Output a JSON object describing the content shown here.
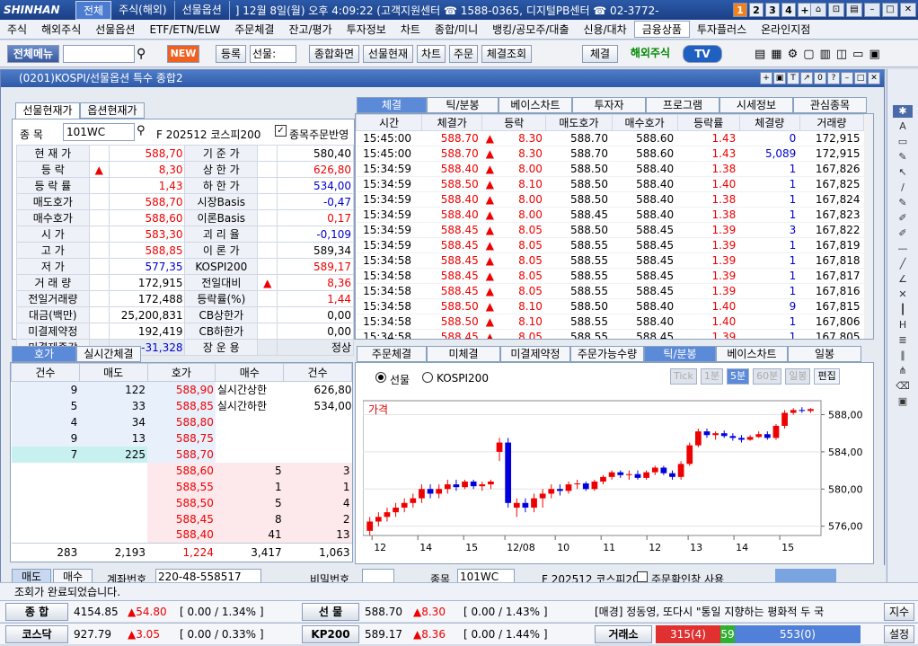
{
  "titlebar": {
    "logo": "SHINHAN",
    "tabs": [
      "전체",
      "주식(해외)",
      "선물옵션"
    ],
    "info": "] 12월 8일(월) 오후 4:09:22 (고객지원센터 ☎ 1588-0365, 디지털PB센터 ☎ 02-3772-",
    "pages": [
      "1",
      "2",
      "3",
      "4",
      "+"
    ]
  },
  "menu": [
    "주식",
    "해외주식",
    "선물옵션",
    "ETF/ETN/ELW",
    "주문체결",
    "잔고/평가",
    "투자정보",
    "차트",
    "종합/미니",
    "뱅킹/공모주/대출",
    "신용/대차",
    "금융상품",
    "투자플러스",
    "온라인지점"
  ],
  "toolbar": {
    "full_menu": "전체메뉴",
    "new_badge": "NEW",
    "register": "등록",
    "select_value": "선물:",
    "composite": "종합화면",
    "futures_now": "선물현재",
    "chart": "차트",
    "order": "주문",
    "fill_query": "체결조회",
    "fill": "체결",
    "overseas": "해외주식",
    "tv": "TV"
  },
  "window": {
    "title": "(0201)KOSPI/선물옵션 특수 종합2"
  },
  "left": {
    "tabs": [
      "선물현재가",
      "옵션현재가"
    ],
    "code_label": "종 목",
    "code": "101WC",
    "name": "F 202512 코스피200",
    "checkbox_label": "종목주문반영",
    "rows": [
      {
        "l1": "현 재 가",
        "v1": "588,70",
        "c1": "red",
        "l2": "기 준 가",
        "v2": "580,40",
        "c2": ""
      },
      {
        "l1": "등 락",
        "v1": "8,30",
        "c1": "red",
        "up": true,
        "l2": "상 한 가",
        "v2": "626,80",
        "c2": "red"
      },
      {
        "l1": "등 락 률",
        "v1": "1,43",
        "c1": "red",
        "l2": "하 한 가",
        "v2": "534,00",
        "c2": "blue"
      },
      {
        "l1": "매도호가",
        "v1": "588,70",
        "c1": "red",
        "l2": "시장Basis",
        "v2": "-0,47",
        "c2": "blue"
      },
      {
        "l1": "매수호가",
        "v1": "588,60",
        "c1": "red",
        "l2": "이론Basis",
        "v2": "0,17",
        "c2": "red"
      },
      {
        "l1": "시 가",
        "v1": "583,30",
        "c1": "red",
        "l2": "괴 리 율",
        "v2": "-0,109",
        "c2": "blue"
      },
      {
        "l1": "고 가",
        "v1": "588,85",
        "c1": "red",
        "l2": "이 론 가",
        "v2": "589,34",
        "c2": ""
      },
      {
        "l1": "저 가",
        "v1": "577,35",
        "c1": "blue",
        "l2": "KOSPI200",
        "v2": "589,17",
        "c2": "red"
      },
      {
        "l1": "거 래 량",
        "v1": "172,915",
        "c1": "",
        "l2": "전일대비",
        "v2": "8,36",
        "c2": "red",
        "up2": true
      },
      {
        "l1": "전일거래량",
        "v1": "172,488",
        "c1": "",
        "l2": "등락률(%)",
        "v2": "1,44",
        "c2": "red"
      },
      {
        "l1": "대금(백만)",
        "v1": "25,200,831",
        "c1": "",
        "l2": "CB상한가",
        "v2": "0,00",
        "c2": ""
      },
      {
        "l1": "미결제약정",
        "v1": "192,419",
        "c1": "",
        "l2": "CB하한가",
        "v2": "0,00",
        "c2": ""
      },
      {
        "l1": "미결제증감",
        "v1": "-31,328",
        "c1": "blue",
        "l2": "장 운 용",
        "v2": "정상",
        "c2": ""
      }
    ]
  },
  "trades": {
    "tabs": [
      "체결",
      "틱/분봉",
      "베이스차트",
      "투자자",
      "프로그램",
      "시세정보",
      "관심종목"
    ],
    "headers": [
      "시간",
      "체결가",
      "등락",
      "매도호가",
      "매수호가",
      "등락률",
      "체결량",
      "거래량"
    ],
    "rows": [
      [
        "15:45:00",
        "588.70",
        "8.30",
        "588.70",
        "588.60",
        "1.43",
        "0",
        "172,915"
      ],
      [
        "15:45:00",
        "588.70",
        "8.30",
        "588.70",
        "588.60",
        "1.43",
        "5,089",
        "172,915"
      ],
      [
        "15:34:59",
        "588.40",
        "8.00",
        "588.50",
        "588.40",
        "1.38",
        "1",
        "167,826"
      ],
      [
        "15:34:59",
        "588.50",
        "8.10",
        "588.50",
        "588.40",
        "1.40",
        "1",
        "167,825"
      ],
      [
        "15:34:59",
        "588.40",
        "8.00",
        "588.50",
        "588.40",
        "1.38",
        "1",
        "167,824"
      ],
      [
        "15:34:59",
        "588.40",
        "8.00",
        "588.45",
        "588.40",
        "1.38",
        "1",
        "167,823"
      ],
      [
        "15:34:59",
        "588.45",
        "8.05",
        "588.50",
        "588.45",
        "1.39",
        "3",
        "167,822"
      ],
      [
        "15:34:59",
        "588.45",
        "8.05",
        "588.55",
        "588.45",
        "1.39",
        "1",
        "167,819"
      ],
      [
        "15:34:58",
        "588.45",
        "8.05",
        "588.55",
        "588.45",
        "1.39",
        "1",
        "167,818"
      ],
      [
        "15:34:58",
        "588.45",
        "8.05",
        "588.55",
        "588.45",
        "1.39",
        "1",
        "167,817"
      ],
      [
        "15:34:58",
        "588.45",
        "8.05",
        "588.55",
        "588.45",
        "1.39",
        "1",
        "167,816"
      ],
      [
        "15:34:58",
        "588.50",
        "8.10",
        "588.50",
        "588.40",
        "1.40",
        "9",
        "167,815"
      ],
      [
        "15:34:58",
        "588.50",
        "8.10",
        "588.55",
        "588.40",
        "1.40",
        "1",
        "167,806"
      ],
      [
        "15:34:58",
        "588.45",
        "8.05",
        "588.55",
        "588.45",
        "1.39",
        "1",
        "167,805"
      ]
    ]
  },
  "hoga": {
    "tabs": [
      "호가",
      "실시간체결"
    ],
    "headers": [
      "건수",
      "매도",
      "호가",
      "매수",
      "건수"
    ],
    "asks": [
      [
        "9",
        "122",
        "588,90"
      ],
      [
        "5",
        "33",
        "588,85"
      ],
      [
        "4",
        "34",
        "588,80"
      ],
      [
        "9",
        "13",
        "588,75"
      ],
      [
        "7",
        "225",
        "588,70"
      ]
    ],
    "bids": [
      [
        "588,60",
        "5",
        "3"
      ],
      [
        "588,55",
        "1",
        "1"
      ],
      [
        "588,50",
        "5",
        "4"
      ],
      [
        "588,45",
        "8",
        "2"
      ],
      [
        "588,40",
        "41",
        "13"
      ]
    ],
    "upper_label": "실시간상한",
    "upper": "626,80",
    "lower_label": "실시간하한",
    "lower": "534,00",
    "totals": [
      "283",
      "2,193",
      "1,224",
      "3,417",
      "1,063"
    ]
  },
  "bottom_form": {
    "sell": "매도",
    "buy": "매수",
    "account_label": "계좌번호",
    "account": "220-48-558517",
    "pw_label": "비밀번호",
    "code_label": "종목",
    "code": "101WC",
    "name": "F 202512 코스피20",
    "check": "주문확인창 사용"
  },
  "chart_panel": {
    "tabs": [
      "주문체결",
      "미체결",
      "미결제약정",
      "주문가능수량",
      "틱/분봉",
      "베이스차트",
      "일봉"
    ],
    "radio1": "선물",
    "radio2": "KOSPI200",
    "buttons": [
      "Tick",
      "1분",
      "5분",
      "60분",
      "일봉",
      "편집"
    ],
    "label": "가격"
  },
  "chart_data": {
    "type": "candlestick",
    "title": "가격",
    "yticks": [
      "588,00",
      "584,00",
      "580,00",
      "576,00"
    ],
    "ylim": [
      575,
      589.5
    ],
    "xticks": [
      "12",
      "14",
      "15",
      "12/08",
      "10",
      "11",
      "12",
      "13",
      "14",
      "15"
    ],
    "candles": [
      [
        575.5,
        577,
        575,
        576.5
      ],
      [
        576.5,
        577.5,
        576,
        577
      ],
      [
        577,
        578,
        576.5,
        577.5
      ],
      [
        577.5,
        578.5,
        577,
        578
      ],
      [
        578,
        579,
        577.5,
        578.5
      ],
      [
        578.5,
        579.5,
        578,
        579
      ],
      [
        579,
        580.5,
        578.5,
        580
      ],
      [
        580,
        580.5,
        579,
        579.5
      ],
      [
        579.5,
        580.5,
        579,
        580
      ],
      [
        580,
        581,
        579.5,
        580.5
      ],
      [
        580.5,
        581,
        579.8,
        580.2
      ],
      [
        580.2,
        581,
        580,
        580.8
      ],
      [
        580.8,
        581,
        580,
        580.3
      ],
      [
        580.3,
        580.8,
        579.8,
        580.5
      ],
      [
        580.5,
        581,
        580,
        580.8
      ],
      [
        584,
        585.5,
        583,
        585
      ],
      [
        585,
        585.5,
        578,
        578.5
      ],
      [
        578,
        579,
        577,
        578.5
      ],
      [
        578.5,
        579,
        577.5,
        578
      ],
      [
        578,
        579.5,
        577.5,
        579
      ],
      [
        579,
        580,
        578,
        579.5
      ],
      [
        579.5,
        580.5,
        579,
        580
      ],
      [
        580,
        580.5,
        579.3,
        579.8
      ],
      [
        579.8,
        580.8,
        579.5,
        580.5
      ],
      [
        580.5,
        581,
        580,
        580.6
      ],
      [
        580.6,
        580.8,
        579.8,
        580
      ],
      [
        580,
        581,
        579.8,
        580.8
      ],
      [
        580.8,
        581.5,
        580.5,
        581.3
      ],
      [
        581.3,
        582,
        581,
        581.8
      ],
      [
        581.8,
        582,
        581.2,
        581.5
      ],
      [
        581.5,
        582,
        581,
        581.6
      ],
      [
        581.6,
        582,
        581,
        581.2
      ],
      [
        581.2,
        582,
        581,
        581.8
      ],
      [
        581.8,
        582.5,
        581.5,
        582.3
      ],
      [
        582.3,
        582.5,
        581.5,
        581.7
      ],
      [
        581.7,
        582,
        581,
        581.3
      ],
      [
        581.3,
        583,
        581,
        582.7
      ],
      [
        582.7,
        585,
        582.5,
        584.7
      ],
      [
        584.7,
        586.5,
        584.5,
        586.2
      ],
      [
        586.2,
        586.5,
        585.5,
        585.8
      ],
      [
        585.8,
        586.2,
        585.3,
        586
      ],
      [
        586,
        586.3,
        585.5,
        585.7
      ],
      [
        585.7,
        586,
        585.2,
        585.5
      ],
      [
        585.5,
        585.8,
        585,
        585.3
      ],
      [
        585.3,
        585.8,
        585.2,
        585.6
      ],
      [
        585.6,
        586.2,
        585.5,
        585.9
      ],
      [
        585.9,
        586.2,
        585.3,
        585.5
      ],
      [
        585.5,
        587,
        585.3,
        586.8
      ],
      [
        586.8,
        588.5,
        586.5,
        588.2
      ],
      [
        588.2,
        588.7,
        588,
        588.5
      ],
      [
        588.5,
        588.8,
        588.2,
        588.4
      ],
      [
        588.4,
        588.7,
        588.2,
        588.6
      ]
    ]
  },
  "status": {
    "message": "조회가 완료되었습니다."
  },
  "ticker1": {
    "label": "종 합",
    "value": "4154.85",
    "chg": "54.80",
    "pct": "[ 0.00 / 1.34% ]",
    "label2": "선 물",
    "value2": "588.70",
    "chg2": "8.30",
    "pct2": "[ 0.00 / 1.43% ]",
    "news": "[매경] 정동영, 또다시 \"통일 지향하는 평화적 두 국",
    "right": "지수"
  },
  "ticker2": {
    "label": "코스닥",
    "value": "927.79",
    "chg": "3.05",
    "pct": "[ 0.00 / 0.33% ]",
    "label2": "KP200",
    "value2": "589.17",
    "chg2": "8.36",
    "pct2": "[ 0.00 / 1.44% ]",
    "label3": "거래소",
    "up": "315(4)",
    "mid": "59",
    "down": "553(0)",
    "right": "설정"
  }
}
